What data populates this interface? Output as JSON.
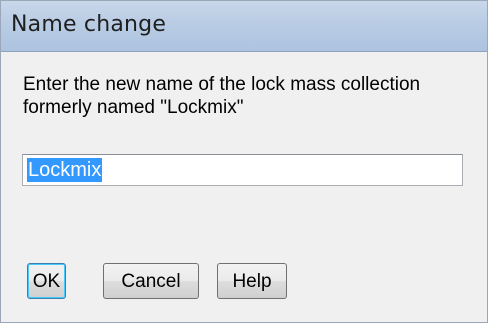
{
  "window": {
    "title": "Name change"
  },
  "dialog": {
    "prompt": "Enter the new name of the lock mass collection formerly named \"Lockmix\"",
    "name_field": {
      "value": "Lockmix",
      "selected": true
    }
  },
  "buttons": {
    "ok_label": "OK",
    "cancel_label": "Cancel",
    "help_label": "Help"
  },
  "colors": {
    "title_bar": "#b9cce4",
    "selection": "#3399ff",
    "dialog_background": "#f0f0f0"
  }
}
